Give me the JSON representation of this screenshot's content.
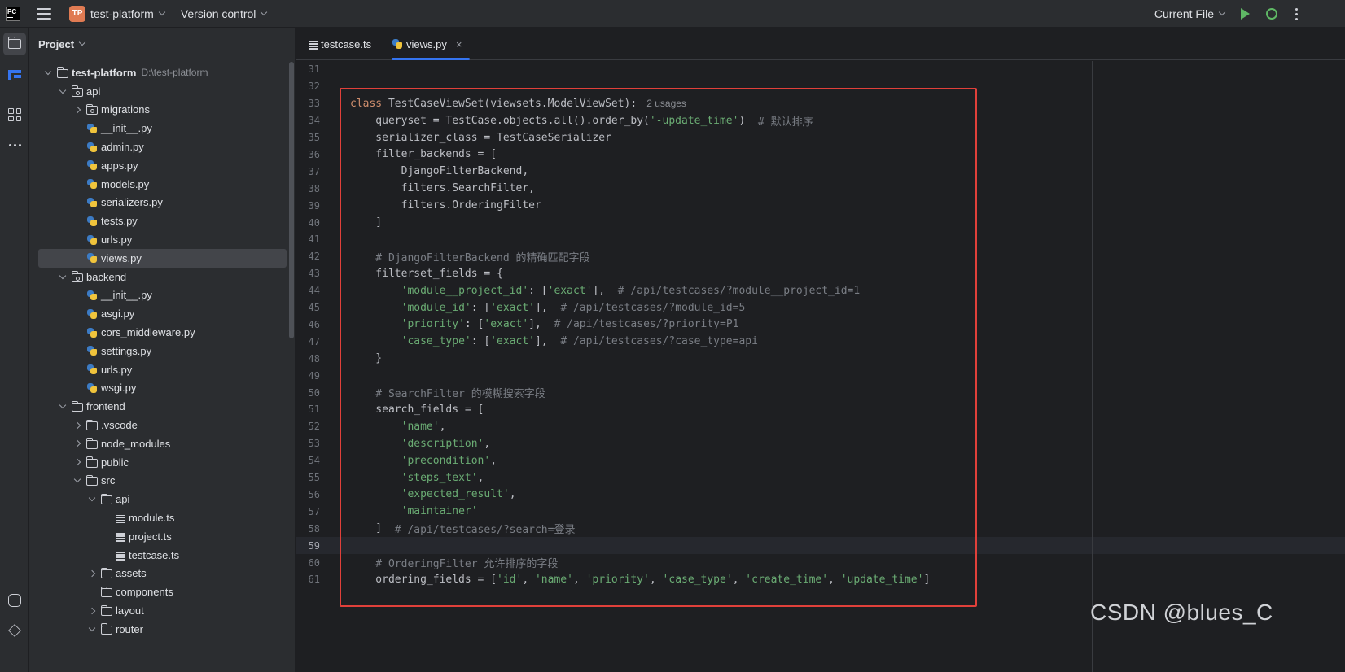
{
  "titlebar": {
    "logo": "PC",
    "project_badge": "TP",
    "project_name": "test-platform",
    "vcs_label": "Version control",
    "run_config": "Current File",
    "icons": [
      "hamburger-icon",
      "run-icon",
      "debug-icon",
      "more-icon"
    ]
  },
  "activity_bar": [
    "project-icon",
    "structure-icon",
    "plugins-icon",
    "more-icon",
    "python-console-icon",
    "layers-icon"
  ],
  "panel": {
    "title": "Project"
  },
  "tree": [
    {
      "label": "test-platform",
      "hint": "D:\\test-platform",
      "depth": 0,
      "arrow": "d",
      "icon": "folder",
      "bold": true
    },
    {
      "label": "api",
      "depth": 1,
      "arrow": "d",
      "icon": "pkg"
    },
    {
      "label": "migrations",
      "depth": 2,
      "arrow": "r",
      "icon": "pkg"
    },
    {
      "label": "__init__.py",
      "depth": 2,
      "arrow": "n",
      "icon": "py"
    },
    {
      "label": "admin.py",
      "depth": 2,
      "arrow": "n",
      "icon": "py"
    },
    {
      "label": "apps.py",
      "depth": 2,
      "arrow": "n",
      "icon": "py"
    },
    {
      "label": "models.py",
      "depth": 2,
      "arrow": "n",
      "icon": "py"
    },
    {
      "label": "serializers.py",
      "depth": 2,
      "arrow": "n",
      "icon": "py"
    },
    {
      "label": "tests.py",
      "depth": 2,
      "arrow": "n",
      "icon": "py"
    },
    {
      "label": "urls.py",
      "depth": 2,
      "arrow": "n",
      "icon": "py"
    },
    {
      "label": "views.py",
      "depth": 2,
      "arrow": "n",
      "icon": "py",
      "selected": true
    },
    {
      "label": "backend",
      "depth": 1,
      "arrow": "d",
      "icon": "pkg"
    },
    {
      "label": "__init__.py",
      "depth": 2,
      "arrow": "n",
      "icon": "py"
    },
    {
      "label": "asgi.py",
      "depth": 2,
      "arrow": "n",
      "icon": "py"
    },
    {
      "label": "cors_middleware.py",
      "depth": 2,
      "arrow": "n",
      "icon": "py"
    },
    {
      "label": "settings.py",
      "depth": 2,
      "arrow": "n",
      "icon": "py"
    },
    {
      "label": "urls.py",
      "depth": 2,
      "arrow": "n",
      "icon": "py"
    },
    {
      "label": "wsgi.py",
      "depth": 2,
      "arrow": "n",
      "icon": "py"
    },
    {
      "label": "frontend",
      "depth": 1,
      "arrow": "d",
      "icon": "folder"
    },
    {
      "label": ".vscode",
      "depth": 2,
      "arrow": "r",
      "icon": "folder"
    },
    {
      "label": "node_modules",
      "depth": 2,
      "arrow": "r",
      "icon": "folder"
    },
    {
      "label": "public",
      "depth": 2,
      "arrow": "r",
      "icon": "folder"
    },
    {
      "label": "src",
      "depth": 2,
      "arrow": "d",
      "icon": "folder"
    },
    {
      "label": "api",
      "depth": 3,
      "arrow": "d",
      "icon": "folder"
    },
    {
      "label": "module.ts",
      "depth": 4,
      "arrow": "n",
      "icon": "ts"
    },
    {
      "label": "project.ts",
      "depth": 4,
      "arrow": "n",
      "icon": "ts"
    },
    {
      "label": "testcase.ts",
      "depth": 4,
      "arrow": "n",
      "icon": "ts"
    },
    {
      "label": "assets",
      "depth": 3,
      "arrow": "r",
      "icon": "folder"
    },
    {
      "label": "components",
      "depth": 3,
      "arrow": "n",
      "icon": "folder"
    },
    {
      "label": "layout",
      "depth": 3,
      "arrow": "r",
      "icon": "folder"
    },
    {
      "label": "router",
      "depth": 3,
      "arrow": "d",
      "icon": "folder"
    }
  ],
  "tabs": [
    {
      "label": "testcase.ts",
      "icon": "ts"
    },
    {
      "label": "views.py",
      "icon": "py",
      "active": true,
      "close": "×"
    }
  ],
  "code": [
    {
      "n": "31",
      "t": []
    },
    {
      "n": "32",
      "t": []
    },
    {
      "n": "33",
      "t": [
        [
          "k",
          "class "
        ],
        [
          "cls",
          "TestCaseViewSet(viewsets.ModelViewSet):"
        ]
      ],
      "hint": "2 usages"
    },
    {
      "n": "34",
      "t": [
        [
          "d",
          "    queryset = TestCase.objects.all().order_by("
        ],
        [
          "s",
          "'-update_time'"
        ],
        [
          "d",
          ")  "
        ],
        [
          "c",
          "# 默认排序"
        ]
      ]
    },
    {
      "n": "35",
      "t": [
        [
          "d",
          "    serializer_class = TestCaseSerializer"
        ]
      ]
    },
    {
      "n": "36",
      "t": [
        [
          "d",
          "    filter_backends = ["
        ]
      ]
    },
    {
      "n": "37",
      "t": [
        [
          "d",
          "        DjangoFilterBackend,"
        ]
      ]
    },
    {
      "n": "38",
      "t": [
        [
          "d",
          "        filters.SearchFilter,"
        ]
      ]
    },
    {
      "n": "39",
      "t": [
        [
          "d",
          "        filters.OrderingFilter"
        ]
      ]
    },
    {
      "n": "40",
      "t": [
        [
          "d",
          "    ]"
        ]
      ]
    },
    {
      "n": "41",
      "t": []
    },
    {
      "n": "42",
      "t": [
        [
          "c",
          "    # DjangoFilterBackend 的精确匹配字段"
        ]
      ]
    },
    {
      "n": "43",
      "t": [
        [
          "d",
          "    filterset_fields = {"
        ]
      ]
    },
    {
      "n": "44",
      "t": [
        [
          "d",
          "        "
        ],
        [
          "s",
          "'module__project_id'"
        ],
        [
          "d",
          ": ["
        ],
        [
          "s",
          "'exact'"
        ],
        [
          "d",
          "],  "
        ],
        [
          "c",
          "# /api/testcases/?module__project_id=1"
        ]
      ]
    },
    {
      "n": "45",
      "t": [
        [
          "d",
          "        "
        ],
        [
          "s",
          "'module_id'"
        ],
        [
          "d",
          ": ["
        ],
        [
          "s",
          "'exact'"
        ],
        [
          "d",
          "],  "
        ],
        [
          "c",
          "# /api/testcases/?module_id=5"
        ]
      ]
    },
    {
      "n": "46",
      "t": [
        [
          "d",
          "        "
        ],
        [
          "s",
          "'priority'"
        ],
        [
          "d",
          ": ["
        ],
        [
          "s",
          "'exact'"
        ],
        [
          "d",
          "],  "
        ],
        [
          "c",
          "# /api/testcases/?priority=P1"
        ]
      ]
    },
    {
      "n": "47",
      "t": [
        [
          "d",
          "        "
        ],
        [
          "s",
          "'case_type'"
        ],
        [
          "d",
          ": ["
        ],
        [
          "s",
          "'exact'"
        ],
        [
          "d",
          "],  "
        ],
        [
          "c",
          "# /api/testcases/?case_type=api"
        ]
      ]
    },
    {
      "n": "48",
      "t": [
        [
          "d",
          "    }"
        ]
      ]
    },
    {
      "n": "49",
      "t": []
    },
    {
      "n": "50",
      "t": [
        [
          "c",
          "    # SearchFilter 的模糊搜索字段"
        ]
      ]
    },
    {
      "n": "51",
      "t": [
        [
          "d",
          "    search_fields = ["
        ]
      ]
    },
    {
      "n": "52",
      "t": [
        [
          "d",
          "        "
        ],
        [
          "s",
          "'name'"
        ],
        [
          "d",
          ","
        ]
      ]
    },
    {
      "n": "53",
      "t": [
        [
          "d",
          "        "
        ],
        [
          "s",
          "'description'"
        ],
        [
          "d",
          ","
        ]
      ]
    },
    {
      "n": "54",
      "t": [
        [
          "d",
          "        "
        ],
        [
          "s",
          "'precondition'"
        ],
        [
          "d",
          ","
        ]
      ]
    },
    {
      "n": "55",
      "t": [
        [
          "d",
          "        "
        ],
        [
          "s",
          "'steps_text'"
        ],
        [
          "d",
          ","
        ]
      ]
    },
    {
      "n": "56",
      "t": [
        [
          "d",
          "        "
        ],
        [
          "s",
          "'expected_result'"
        ],
        [
          "d",
          ","
        ]
      ]
    },
    {
      "n": "57",
      "t": [
        [
          "d",
          "        "
        ],
        [
          "s",
          "'maintainer'"
        ]
      ]
    },
    {
      "n": "58",
      "t": [
        [
          "d",
          "    ]  "
        ],
        [
          "c",
          "# /api/testcases/?search=登录"
        ]
      ]
    },
    {
      "n": "59",
      "t": [],
      "current": true
    },
    {
      "n": "60",
      "t": [
        [
          "c",
          "    # OrderingFilter 允许排序的字段"
        ]
      ]
    },
    {
      "n": "61",
      "t": [
        [
          "d",
          "    ordering_fields = ["
        ],
        [
          "s",
          "'id'"
        ],
        [
          "d",
          ", "
        ],
        [
          "s",
          "'name'"
        ],
        [
          "d",
          ", "
        ],
        [
          "s",
          "'priority'"
        ],
        [
          "d",
          ", "
        ],
        [
          "s",
          "'case_type'"
        ],
        [
          "d",
          ", "
        ],
        [
          "s",
          "'create_time'"
        ],
        [
          "d",
          ", "
        ],
        [
          "s",
          "'update_time'"
        ],
        [
          "d",
          "]"
        ]
      ]
    }
  ],
  "watermark": "CSDN @blues_C",
  "colors": {
    "accent": "#3574f0",
    "highlight_box": "#e0403a",
    "keyword": "#cf8e6d",
    "string": "#6aab73",
    "comment": "#7a7e85"
  }
}
